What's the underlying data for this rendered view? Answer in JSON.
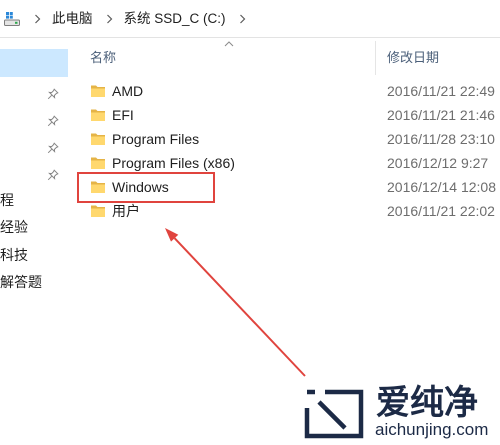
{
  "address_bar": {
    "icon": "drive-icon",
    "separator_icon": "chevron-right-icon",
    "segments": [
      "此电脑",
      "系统 SSD_C (C:)"
    ]
  },
  "nav_pane": {
    "pin_icon": "pin-icon",
    "items": [
      {
        "selected": true
      },
      {
        "pinned": true
      },
      {
        "pinned": true
      },
      {
        "pinned": true
      },
      {
        "pinned": true
      },
      {
        "label": "程"
      },
      {
        "label": "经验"
      },
      {
        "label": "科技"
      },
      {
        "label": "解答题"
      }
    ]
  },
  "file_list": {
    "columns": {
      "name": "名称",
      "modified": "修改日期"
    },
    "sort_icon": "chevron-up-icon",
    "row_icon": "folder-icon",
    "rows": [
      {
        "name": "AMD",
        "modified": "2016/11/21 22:49"
      },
      {
        "name": "EFI",
        "modified": "2016/11/21 21:46"
      },
      {
        "name": "Program Files",
        "modified": "2016/11/28 23:10"
      },
      {
        "name": "Program Files (x86)",
        "modified": "2016/12/12 9:27"
      },
      {
        "name": "Windows",
        "modified": "2016/12/14 12:08",
        "highlighted": true
      },
      {
        "name": "用户",
        "modified": "2016/11/21 22:02"
      }
    ]
  },
  "watermark": {
    "logo_icon": "brand-logo-icon",
    "brand": "爱纯净",
    "url": "aichunjing.com"
  },
  "colors": {
    "selection": "#cce8ff",
    "annotation": "#e0443e",
    "header_text": "#4c607a",
    "date_text": "#6d6d6d",
    "name_text": "#1e1e1e",
    "folder_front": "#ffd86e",
    "folder_back": "#e5b447",
    "watermark": "#1c2a46"
  }
}
